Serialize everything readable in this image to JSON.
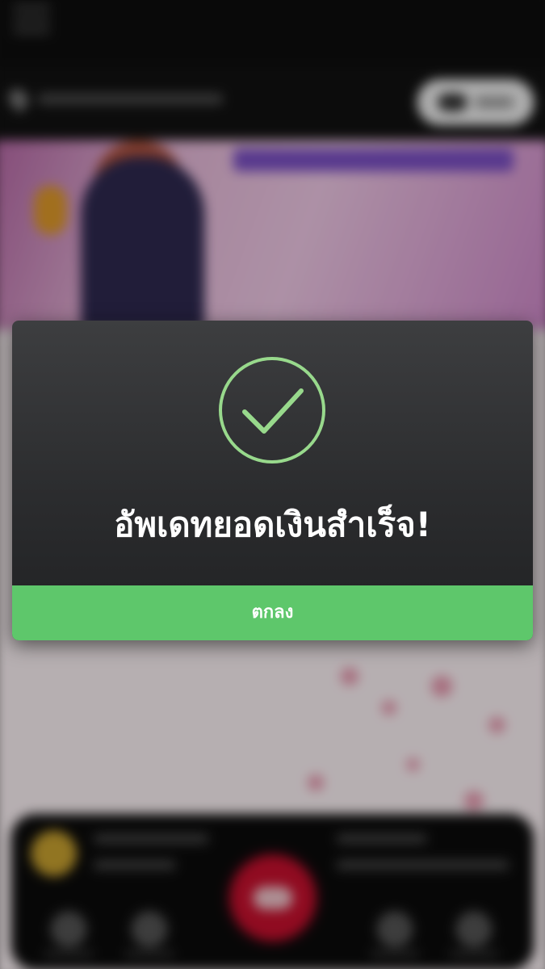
{
  "dialog": {
    "icon": "check-circle-icon",
    "message": "อัพเดทยอดเงินสำเร็จ!",
    "ok_label": "ตกลง"
  },
  "colors": {
    "accent_green": "#5ec76b",
    "icon_green": "#98d98c",
    "dialog_bg": "#2f3032",
    "play_button": "#c8102e"
  },
  "icons": {
    "menu": "hamburger-menu-icon",
    "location": "location-pin-icon",
    "cloud": "cloud-icon",
    "coin": "coin-icon",
    "play": "gamepad-icon"
  }
}
